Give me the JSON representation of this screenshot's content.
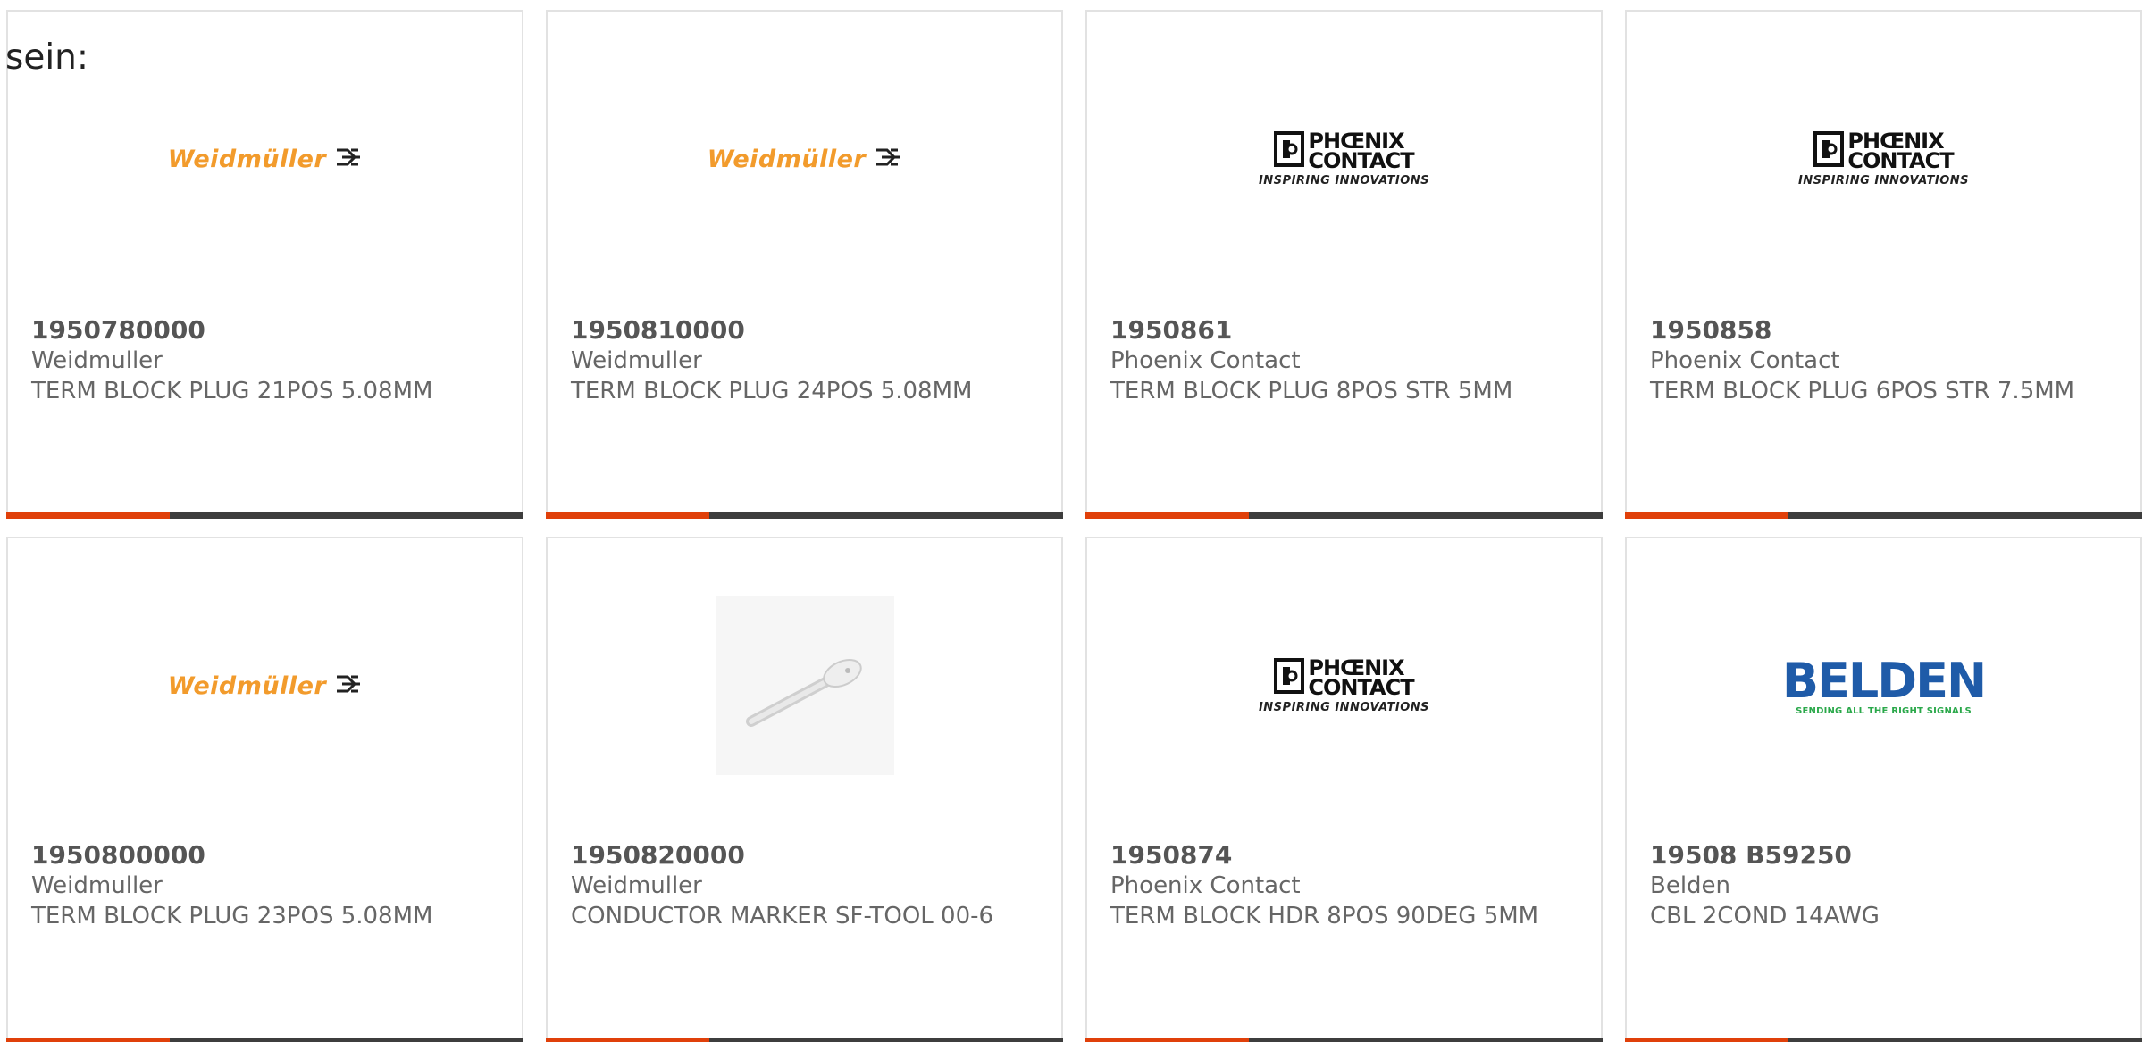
{
  "intro_text": "sein:",
  "colors": {
    "accent": "#e0400a",
    "bar": "#3d3d3d",
    "weidmuller_orange": "#f29b2c",
    "belden_blue": "#1f5ba8",
    "belden_green": "#2aa84a"
  },
  "logos": {
    "weidmuller": {
      "text": "Weidmüller",
      "icon": "weidmuller-symbol-icon"
    },
    "phoenix": {
      "line1": "PHŒNIX",
      "line2": "CONTACT",
      "tagline": "INSPIRING INNOVATIONS",
      "icon": "phoenix-symbol-icon"
    },
    "belden": {
      "text": "BELDEN",
      "tagline": "SENDING ALL THE RIGHT SIGNALS"
    }
  },
  "products": [
    {
      "part_number": "1950780000",
      "manufacturer": "Weidmuller",
      "description": "TERM BLOCK PLUG 21POS 5.08MM",
      "image": "weidmuller-logo"
    },
    {
      "part_number": "1950810000",
      "manufacturer": "Weidmuller",
      "description": "TERM BLOCK PLUG 24POS 5.08MM",
      "image": "weidmuller-logo"
    },
    {
      "part_number": "1950861",
      "manufacturer": "Phoenix Contact",
      "description": "TERM BLOCK PLUG 8POS STR 5MM",
      "image": "phoenix-logo"
    },
    {
      "part_number": "1950858",
      "manufacturer": "Phoenix Contact",
      "description": "TERM BLOCK PLUG 6POS STR 7.5MM",
      "image": "phoenix-logo"
    },
    {
      "part_number": "1950800000",
      "manufacturer": "Weidmuller",
      "description": "TERM BLOCK PLUG 23POS 5.08MM",
      "image": "weidmuller-logo"
    },
    {
      "part_number": "1950820000",
      "manufacturer": "Weidmuller",
      "description": "CONDUCTOR MARKER SF-TOOL 00-6",
      "image": "marker-tool-photo"
    },
    {
      "part_number": "1950874",
      "manufacturer": "Phoenix Contact",
      "description": "TERM BLOCK HDR 8POS 90DEG 5MM",
      "image": "phoenix-logo"
    },
    {
      "part_number": "19508 B59250",
      "manufacturer": "Belden",
      "description": "CBL 2COND 14AWG",
      "image": "belden-logo"
    }
  ]
}
